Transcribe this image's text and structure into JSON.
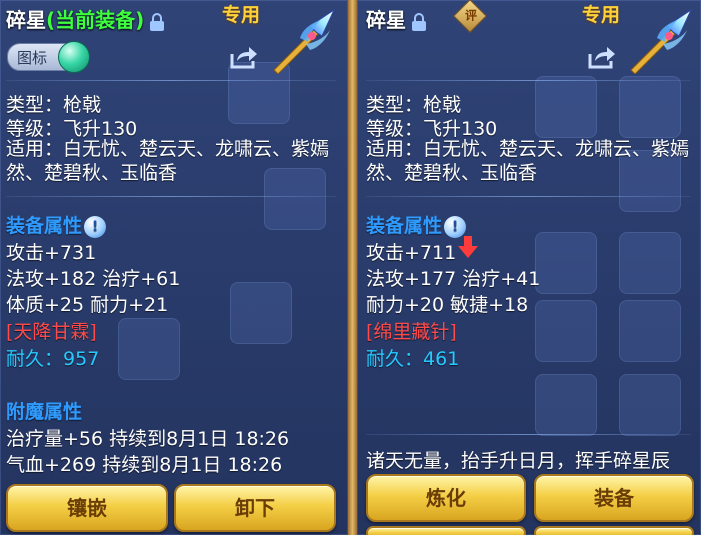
{
  "left_panel": {
    "title_name": "碎星",
    "title_status": "(当前装备)",
    "special_label": "专用",
    "icon_toggle_label": "图标",
    "type_line": "类型：枪戟",
    "level_line": "等级：飞升130",
    "applicable_line": "适用：白无忧、楚云天、龙啸云、紫嫣然、楚碧秋、玉临香",
    "attributes_header": "装备属性",
    "attack": "攻击+731",
    "magic_heal": "法攻+182 治疗+61",
    "stats": "体质+25 耐力+21",
    "special_effect": "[天降甘霖]",
    "durability_label": "耐久：",
    "durability_value": "957",
    "enchant_header": "附魔属性",
    "enchant_1": "治疗量+56 持续到8月1日 18:26",
    "enchant_2": "气血+269 持续到8月1日 18:26",
    "buttons": {
      "inlay": "镶嵌",
      "unequip": "卸下"
    }
  },
  "right_panel": {
    "title_name": "碎星",
    "rate_badge": "评",
    "special_label": "专用",
    "type_line": "类型：枪戟",
    "level_line": "等级：飞升130",
    "applicable_line": "适用：白无忧、楚云天、龙啸云、紫嫣然、楚碧秋、玉临香",
    "attributes_header": "装备属性",
    "attack": "攻击+711",
    "magic_heal": "法攻+177 治疗+41",
    "stats": "耐力+20 敏捷+18",
    "special_effect": "[绵里藏针]",
    "durability_label": "耐久：",
    "durability_value": "461",
    "flavor_text": "诸天无量，抬手升日月，挥手碎星辰",
    "buttons": {
      "refine": "炼化",
      "equip": "装备"
    }
  }
}
